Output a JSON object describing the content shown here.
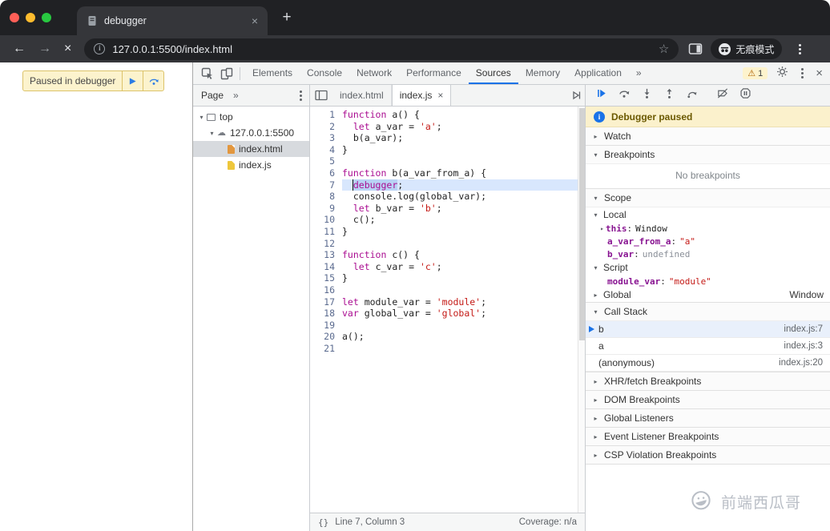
{
  "browser": {
    "tab": {
      "title": "debugger"
    },
    "nav": {
      "url": "127.0.0.1:5500/index.html",
      "incognito_label": "无痕模式"
    }
  },
  "icons": {
    "back": "←",
    "forward": "→",
    "stop": "×",
    "star": "☆",
    "new_tab": "+",
    "close": "×",
    "overflow": "»",
    "warning": "⚠",
    "tri_open": "▾",
    "tri_closed": "▸",
    "cloud": "☁",
    "format": "{}",
    "info": "i"
  },
  "page": {
    "paused_banner": {
      "label": "Paused in debugger"
    }
  },
  "devtools": {
    "main_tabs": {
      "items": [
        "Elements",
        "Console",
        "Network",
        "Performance",
        "Sources",
        "Memory",
        "Application"
      ],
      "active": "Sources",
      "overflow": "»",
      "warning_count": "1"
    },
    "navigator": {
      "tab": "Page",
      "overflow": "»",
      "tree": [
        {
          "label": "top",
          "icon": "frame",
          "depth": 0,
          "expander": "▾"
        },
        {
          "label": "127.0.0.1:5500",
          "icon": "cloud",
          "depth": 1,
          "expander": "▾"
        },
        {
          "label": "index.html",
          "icon": "html",
          "depth": 2,
          "selected": true
        },
        {
          "label": "index.js",
          "icon": "js",
          "depth": 2
        }
      ]
    },
    "editor": {
      "tabs": [
        {
          "label": "index.html",
          "active": false
        },
        {
          "label": "index.js",
          "active": true
        }
      ],
      "lines": [
        {
          "n": 1,
          "tokens": [
            [
              "k",
              "function"
            ],
            [
              "p",
              " a() {"
            ]
          ]
        },
        {
          "n": 2,
          "tokens": [
            [
              "p",
              "  "
            ],
            [
              "k",
              "let"
            ],
            [
              "p",
              " a_var = "
            ],
            [
              "s",
              "'a'"
            ],
            [
              "p",
              ";"
            ]
          ]
        },
        {
          "n": 3,
          "tokens": [
            [
              "p",
              "  b(a_var);"
            ]
          ]
        },
        {
          "n": 4,
          "tokens": [
            [
              "p",
              "}"
            ]
          ]
        },
        {
          "n": 5,
          "tokens": []
        },
        {
          "n": 6,
          "tokens": [
            [
              "k",
              "function"
            ],
            [
              "p",
              " b(a_var_from_a) {"
            ]
          ]
        },
        {
          "n": 7,
          "paused": true,
          "tokens": [
            [
              "p",
              "  "
            ],
            [
              "ksel",
              "debugger"
            ],
            [
              "p",
              ";"
            ]
          ]
        },
        {
          "n": 8,
          "tokens": [
            [
              "p",
              "  console.log(global_var);"
            ]
          ]
        },
        {
          "n": 9,
          "tokens": [
            [
              "p",
              "  "
            ],
            [
              "k",
              "let"
            ],
            [
              "p",
              " b_var = "
            ],
            [
              "s",
              "'b'"
            ],
            [
              "p",
              ";"
            ]
          ]
        },
        {
          "n": 10,
          "tokens": [
            [
              "p",
              "  c();"
            ]
          ]
        },
        {
          "n": 11,
          "tokens": [
            [
              "p",
              "}"
            ]
          ]
        },
        {
          "n": 12,
          "tokens": []
        },
        {
          "n": 13,
          "tokens": [
            [
              "k",
              "function"
            ],
            [
              "p",
              " c() {"
            ]
          ]
        },
        {
          "n": 14,
          "tokens": [
            [
              "p",
              "  "
            ],
            [
              "k",
              "let"
            ],
            [
              "p",
              " c_var = "
            ],
            [
              "s",
              "'c'"
            ],
            [
              "p",
              ";"
            ]
          ]
        },
        {
          "n": 15,
          "tokens": [
            [
              "p",
              "}"
            ]
          ]
        },
        {
          "n": 16,
          "tokens": []
        },
        {
          "n": 17,
          "tokens": [
            [
              "k",
              "let"
            ],
            [
              "p",
              " module_var = "
            ],
            [
              "s",
              "'module'"
            ],
            [
              "p",
              ";"
            ]
          ]
        },
        {
          "n": 18,
          "tokens": [
            [
              "k",
              "var"
            ],
            [
              "p",
              " global_var = "
            ],
            [
              "s",
              "'global'"
            ],
            [
              "p",
              ";"
            ]
          ]
        },
        {
          "n": 19,
          "tokens": []
        },
        {
          "n": 20,
          "tokens": [
            [
              "p",
              "a();"
            ]
          ]
        },
        {
          "n": 21,
          "tokens": []
        }
      ],
      "status": {
        "format_icon": "{}",
        "line_col": "Line 7, Column 3",
        "coverage": "Coverage: n/a"
      }
    },
    "debugger": {
      "paused_message": "Debugger paused",
      "watch": {
        "title": "Watch"
      },
      "breakpoints": {
        "title": "Breakpoints",
        "empty": "No breakpoints"
      },
      "scope": {
        "title": "Scope",
        "groups": [
          {
            "name": "Local",
            "expanded": true,
            "vars": [
              {
                "expander": true,
                "name": "this",
                "value": "Window",
                "vtype": "obj"
              },
              {
                "name": "a_var_from_a",
                "value": "\"a\"",
                "vtype": "str"
              },
              {
                "name": "b_var",
                "value": "undefined",
                "vtype": "undef"
              }
            ]
          },
          {
            "name": "Script",
            "expanded": true,
            "vars": [
              {
                "name": "module_var",
                "value": "\"module\"",
                "vtype": "str"
              }
            ]
          },
          {
            "name": "Global",
            "expanded": false,
            "right": "Window",
            "vars": []
          }
        ]
      },
      "call_stack": {
        "title": "Call Stack",
        "frames": [
          {
            "fn": "b",
            "loc": "index.js:7",
            "active": true
          },
          {
            "fn": "a",
            "loc": "index.js:3"
          },
          {
            "fn": "(anonymous)",
            "loc": "index.js:20"
          }
        ]
      },
      "collapsed_sections": [
        "XHR/fetch Breakpoints",
        "DOM Breakpoints",
        "Global Listeners",
        "Event Listener Breakpoints",
        "CSP Violation Breakpoints"
      ]
    }
  },
  "watermark": {
    "label": "前端西瓜哥"
  },
  "colors": {
    "accent_blue": "#1a73e8",
    "keyword": "#aa0d91",
    "string": "#c41a16",
    "var_name": "#881391",
    "paused_line_bg": "#d8e7fd",
    "selection_bg": "#b9d3f5",
    "warning_bg": "#fdf3cd",
    "traffic": [
      "#ff5f57",
      "#febc2e",
      "#28c840"
    ]
  }
}
